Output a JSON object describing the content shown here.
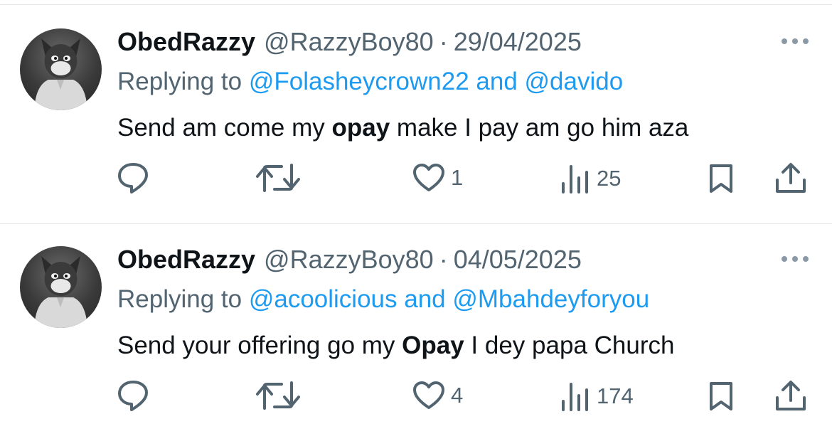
{
  "tweets": [
    {
      "name": "ObedRazzy",
      "handle": "@RazzyBoy80",
      "separator": "·",
      "date": "29/04/2025",
      "replying_prefix": "Replying to ",
      "replying_user1": "@Folasheycrown22",
      "replying_and": " and ",
      "replying_user2": "@davido",
      "text_before": "Send am come my ",
      "text_bold": "opay",
      "text_after": " make I pay am go him aza",
      "likes": "1",
      "views": "25",
      "icons": {
        "reply": "reply-icon",
        "retweet": "retweet-icon",
        "like": "heart-icon",
        "views": "views-icon",
        "bookmark": "bookmark-icon",
        "share": "share-icon",
        "more": "more-icon"
      }
    },
    {
      "name": "ObedRazzy",
      "handle": "@RazzyBoy80",
      "separator": "·",
      "date": "04/05/2025",
      "replying_prefix": "Replying to ",
      "replying_user1": "@acoolicious",
      "replying_and": " and ",
      "replying_user2": "@Mbahdeyforyou",
      "text_before": "Send your offering go my ",
      "text_bold": "Opay",
      "text_after": " I dey papa Church",
      "likes": "4",
      "views": "174",
      "icons": {
        "reply": "reply-icon",
        "retweet": "retweet-icon",
        "like": "heart-icon",
        "views": "views-icon",
        "bookmark": "bookmark-icon",
        "share": "share-icon",
        "more": "more-icon"
      }
    }
  ],
  "colors": {
    "link": "#1d9bf0",
    "secondary_text": "#536471",
    "primary_text": "#0f1419",
    "divider": "#e6e9ec"
  }
}
